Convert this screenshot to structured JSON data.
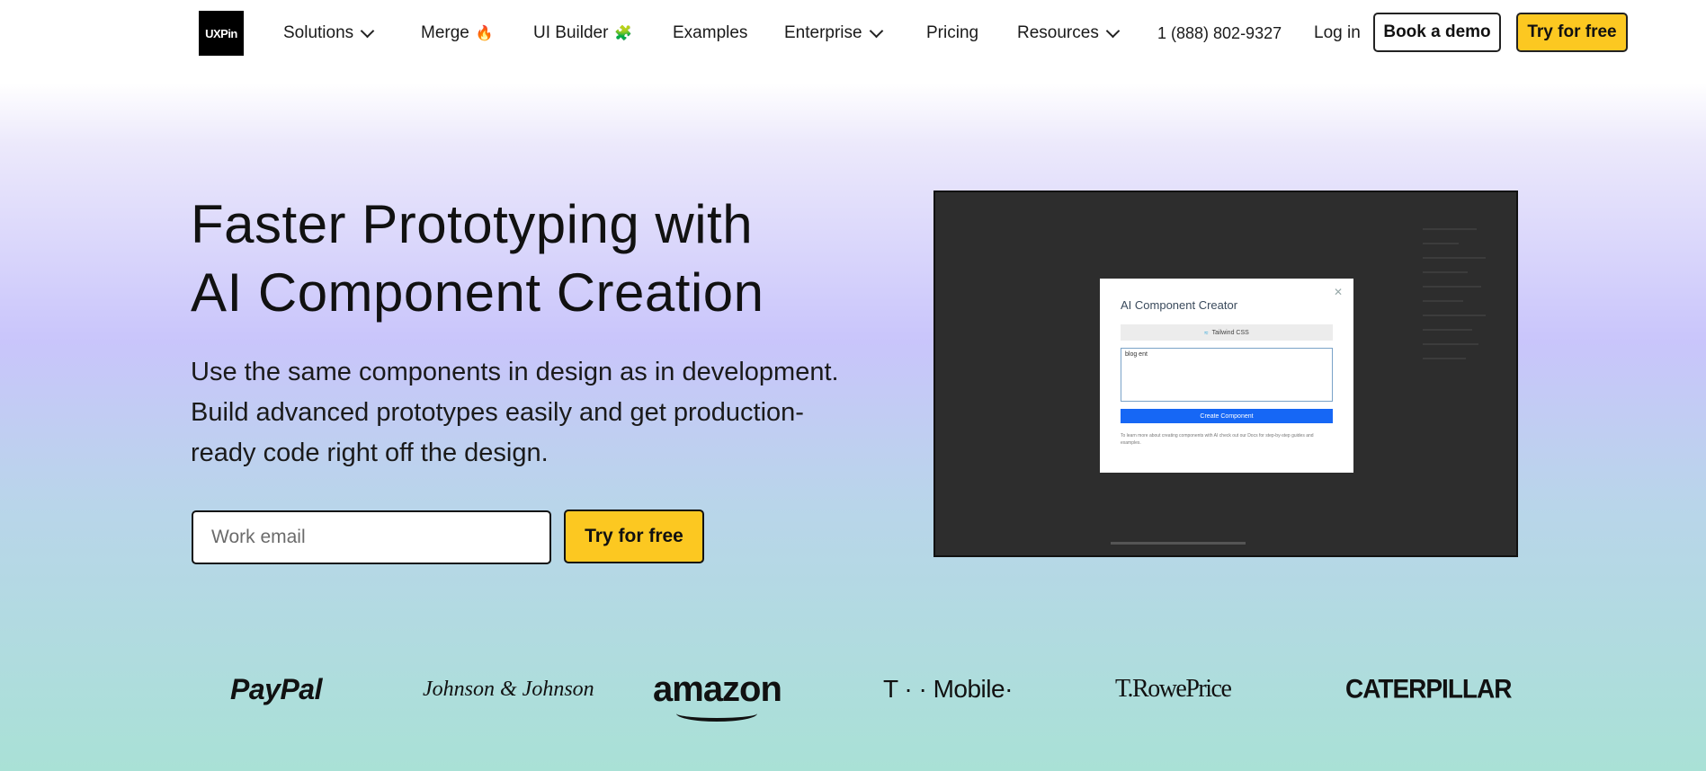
{
  "nav": {
    "logo_text": "UXPin",
    "items": [
      {
        "label": "Solutions",
        "has_chevron": true
      },
      {
        "label": "Merge",
        "emoji": "🔥"
      },
      {
        "label": "UI Builder",
        "emoji": "🧩"
      },
      {
        "label": "Examples"
      },
      {
        "label": "Enterprise",
        "has_chevron": true
      },
      {
        "label": "Pricing"
      },
      {
        "label": "Resources",
        "has_chevron": true
      }
    ],
    "phone": "1 (888) 802-9327",
    "login": "Log in",
    "book_demo": "Book a demo",
    "try_free": "Try for free"
  },
  "hero": {
    "title_line1": "Faster Prototyping with",
    "title_line2": "AI Component Creation",
    "subtitle": "Use the same components in design as in development. Build advanced prototypes easily and get production-ready code right off the design.",
    "email_placeholder": "Work email",
    "email_value": "",
    "cta": "Try for free"
  },
  "mockup": {
    "dialog_title": "AI Component Creator",
    "tab_label": "Tailwind CSS",
    "prompt_text": "blog ent",
    "create_button": "Create Component",
    "note": "To learn more about creating components with AI check out our Docs for step-by-step guides and examples."
  },
  "brands": {
    "paypal": "PayPal",
    "jnj": "Johnson & Johnson",
    "amazon": "amazon",
    "tmobile": "T · · Mobile·",
    "trowe": "T.RowePrice",
    "cat": "CATERPILLAR"
  },
  "colors": {
    "accent_yellow": "#fcc821",
    "primary_blue": "#1667f5",
    "mockup_bg": "#2d2d2d"
  }
}
